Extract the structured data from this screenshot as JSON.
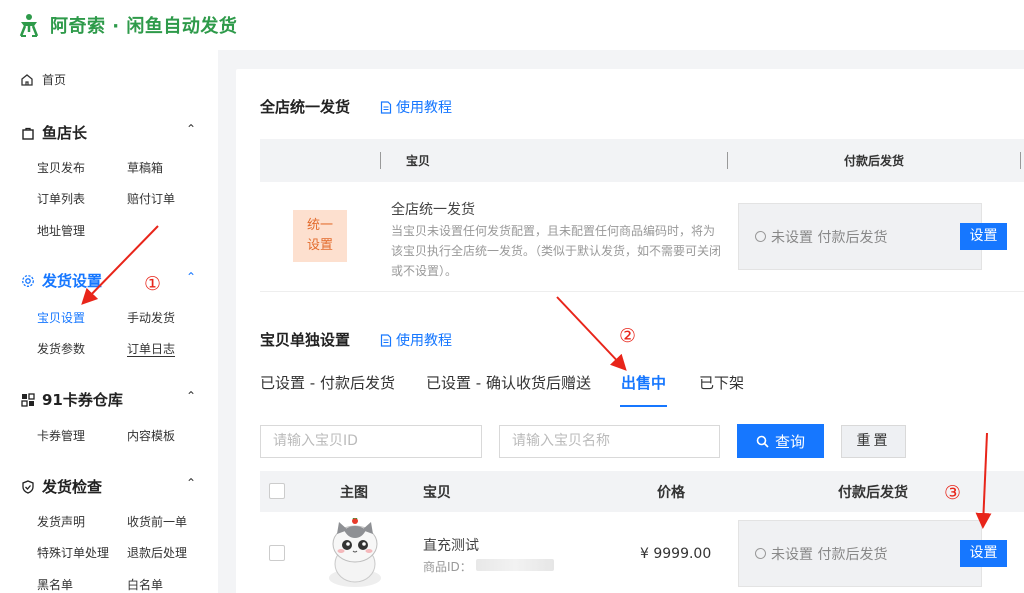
{
  "app": {
    "brand": "阿奇索 · 闲鱼自动发货"
  },
  "sidebar": {
    "home": "首页",
    "sections": [
      {
        "title": "鱼店长",
        "icon": "bag-icon",
        "items": [
          "宝贝发布",
          "草稿箱",
          "订单列表",
          "赔付订单",
          "地址管理"
        ]
      },
      {
        "title": "发货设置",
        "icon": "gear-icon",
        "items": [
          "宝贝设置",
          "手动发货",
          "发货参数",
          "订单日志"
        ]
      },
      {
        "title": "91卡券仓库",
        "icon": "grid-icon",
        "items": [
          "卡券管理",
          "内容模板"
        ]
      },
      {
        "title": "发货检查",
        "icon": "shield-icon",
        "items": [
          "发货声明",
          "收货前一单",
          "特殊订单处理",
          "退款后处理",
          "黑名单",
          "白名单"
        ]
      }
    ]
  },
  "main": {
    "store_section": {
      "title": "全店统一发货",
      "tutorial": "使用教程",
      "columns": [
        "宝贝",
        "付款后发货"
      ],
      "row": {
        "badge": "统一\n设置",
        "title": "全店统一发货",
        "desc": "当宝贝未设置任何发货配置，且未配置任何商品编码时，将为该宝贝执行全店统一发货。（类似于默认发货，如不需要可关闭或不设置）。",
        "status": "未设置 付款后发货",
        "button": "设置"
      }
    },
    "item_section": {
      "title": "宝贝单独设置",
      "tutorial": "使用教程",
      "tabs": [
        "已设置 - 付款后发货",
        "已设置 - 确认收货后赠送",
        "出售中",
        "已下架"
      ],
      "active_tab": "出售中",
      "search_id_placeholder": "请输入宝贝ID",
      "search_name_placeholder": "请输入宝贝名称",
      "query_button": "查询",
      "reset_button": "重置",
      "columns": [
        "主图",
        "宝贝",
        "价格",
        "付款后发货"
      ],
      "products": [
        {
          "name": "直充测试",
          "id_label": "商品ID：",
          "price": "¥ 9999.00",
          "status": "未设置 付款后发货",
          "button": "设置"
        }
      ]
    }
  },
  "annotations": {
    "marks": [
      "①",
      "②",
      "③"
    ],
    "color": "#e8251a"
  }
}
